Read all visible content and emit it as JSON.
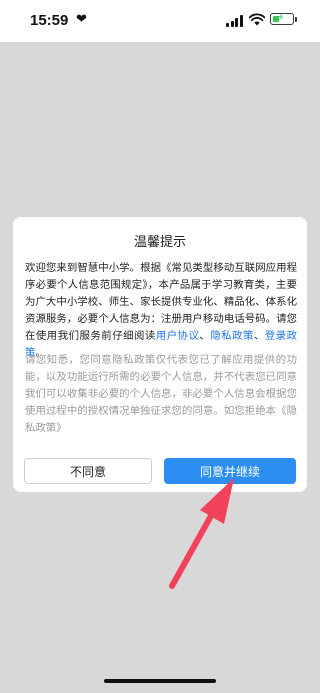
{
  "status_bar": {
    "time": "15:59",
    "heart_icon": "heart-icon",
    "signal_icon": "signal-icon",
    "wifi_icon": "wifi-icon",
    "battery_icon": "battery-charging-icon",
    "battery_color": "#34c759"
  },
  "dialog": {
    "title": "温馨提示",
    "body_part1": "欢迎您来到智慧中小学。根据《常见类型移动互联网应用程序必要个人信息范围规定》，本产品属于学习教育类，主要为广大中小学校、师生、家长提供专业化、精品化、体系化资源服务，必要个人信息为：注册用户移动电话号码。请您在使用我们服务前仔细阅读",
    "link_user_agreement": "用户协议",
    "sep1": "、",
    "link_privacy_policy": "隐私政策",
    "sep2": "、",
    "link_login_policy": "登录政策",
    "body_end": "。",
    "notice": "请您知悉，您同意隐私政策仅代表您已了解应用提供的功能，以及功能运行所需的必要个人信息，并不代表您已同意我们可以收集非必要的个人信息，非必要个人信息会根据您使用过程中的授权情况单独征求您的同意。如您拒绝本《隐私政策》",
    "decline_label": "不同意",
    "agree_label": "同意并继续"
  },
  "colors": {
    "link": "#1a73e8",
    "primary_button": "#2b8ef0",
    "annotation_arrow": "#f0425a",
    "backdrop": "#d8d8d8"
  }
}
